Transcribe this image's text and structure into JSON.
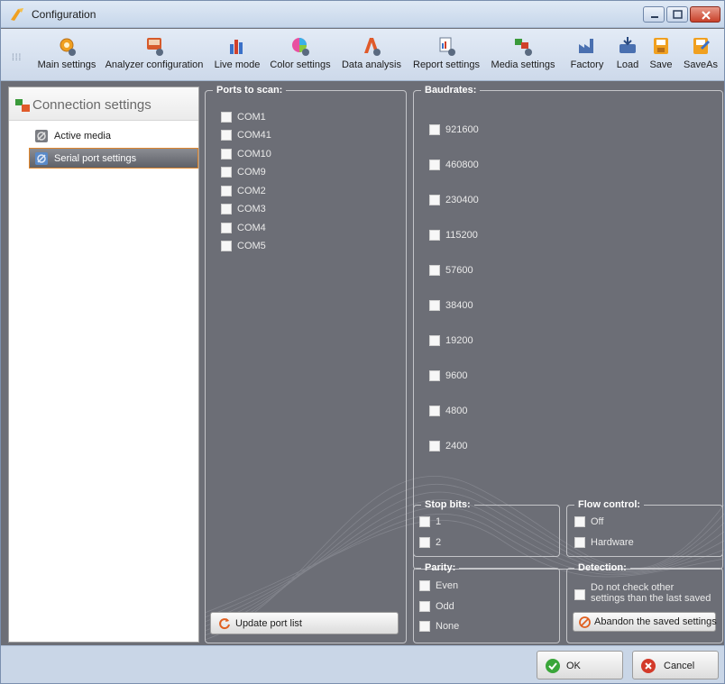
{
  "window": {
    "title": "Configuration"
  },
  "toolbar": {
    "items": [
      {
        "label": "Main settings",
        "icon": "gear-icon"
      },
      {
        "label": "Analyzer configuration",
        "icon": "analyzer-icon"
      },
      {
        "label": "Live mode",
        "icon": "bar-chart-icon"
      },
      {
        "label": "Color settings",
        "icon": "color-wheel-icon"
      },
      {
        "label": "Data analysis",
        "icon": "analysis-icon"
      },
      {
        "label": "Report settings",
        "icon": "report-icon"
      },
      {
        "label": "Media settings",
        "icon": "media-icon"
      },
      {
        "label": "Factory",
        "icon": "factory-icon"
      },
      {
        "label": "Load",
        "icon": "load-icon"
      },
      {
        "label": "Save",
        "icon": "save-icon"
      },
      {
        "label": "SaveAs",
        "icon": "save-as-icon"
      }
    ]
  },
  "sidebar": {
    "header": "Connection settings",
    "items": [
      {
        "label": "Active media",
        "active": false
      },
      {
        "label": "Serial port settings",
        "active": true
      }
    ]
  },
  "ports": {
    "legend": "Ports to scan:",
    "items": [
      "COM1",
      "COM41",
      "COM10",
      "COM9",
      "COM2",
      "COM3",
      "COM4",
      "COM5"
    ],
    "update_button": "Update port list"
  },
  "baudrates": {
    "legend": "Baudrates:",
    "items": [
      "921600",
      "460800",
      "230400",
      "115200",
      "57600",
      "38400",
      "19200",
      "9600",
      "4800",
      "2400"
    ]
  },
  "stop_bits": {
    "legend": "Stop bits:",
    "items": [
      "1",
      "2"
    ]
  },
  "flow_control": {
    "legend": "Flow control:",
    "items": [
      "Off",
      "Hardware"
    ]
  },
  "parity": {
    "legend": "Parity:",
    "items": [
      "Even",
      "Odd",
      "None"
    ]
  },
  "detection": {
    "legend": "Detection:",
    "checkbox_label_line1": "Do not check other",
    "checkbox_label_line2": "settings than the last saved",
    "abandon_button": "Abandon the saved settings"
  },
  "footer": {
    "ok": "OK",
    "cancel": "Cancel"
  },
  "colors": {
    "accent_orange": "#e0862c",
    "panel_gray": "#6c6e76",
    "ok_green": "#3aa63a",
    "cancel_red": "#d33a2a"
  }
}
